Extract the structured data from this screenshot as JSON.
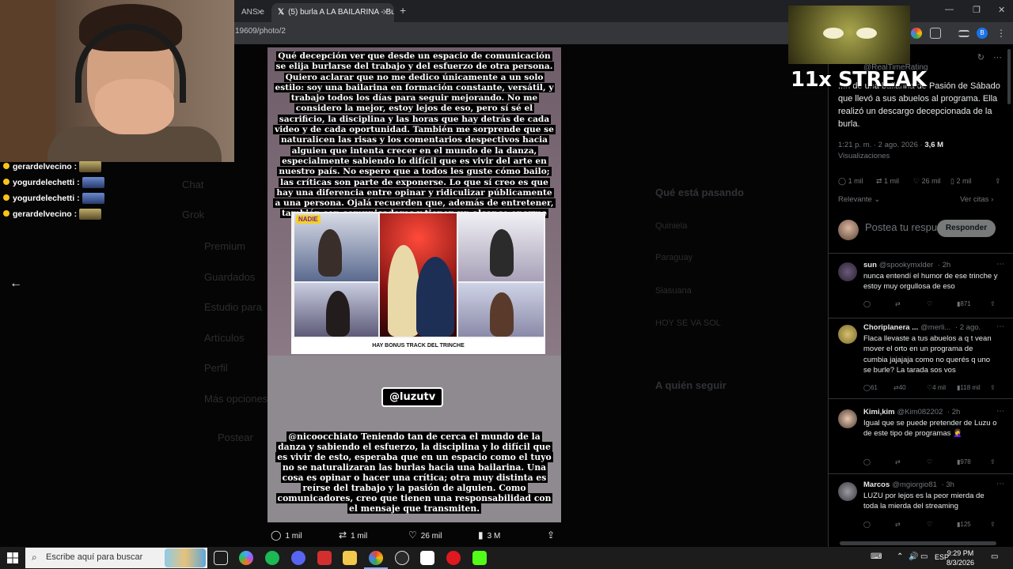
{
  "browser": {
    "tab_prev_label": "ANS e",
    "tab_active_label": "(5) burla A LA BAILARINA - Bus",
    "url_fragment": "19609/photo/2"
  },
  "media": {
    "caption_top": "Qué decepción ver que desde un espacio de comunicación se elija burlarse del trabajo y del esfuerzo de otra persona. Quiero aclarar que no me dedico únicamente a un solo estilo: soy una bailarina en formación constante, versátil, y trabajo todos los días para seguir mejorando. No me considero la mejor, estoy lejos de eso, pero sí sé el sacrificio, la disciplina y las horas que hay detrás de cada video y de cada oportunidad. También me sorprende que se naturalicen las risas y los comentarios despectivos hacia alguien que intenta crecer en el mundo de la danza, especialmente sabiendo lo difícil que es vivir del arte en nuestro país. No espero que a todos les guste cómo bailo; las críticas son parte de exponerse. Lo que sí creo es que hay una diferencia entre opinar y ridiculizar públicamente a una persona. Ojalá recuerden que, además de entretener, también son comunicadores y tienen un alcance enorme sobre mucha gente.",
    "collage_logo": "NADIE",
    "collage_banner": "HAY BONUS TRACK DEL TRINCHE",
    "tag": "@luzutv",
    "caption_bottom": "@nicoocchiato Teniendo tan de cerca el mundo de la danza y sabiendo el esfuerzo, la disciplina y lo difícil que es vivir de esto, esperaba que en un espacio como el tuyo no se naturalizaran las burlas hacia una bailarina. Una cosa es opinar o hacer una crítica; otra muy distinta es reírse del trabajo y la pasión de alguien. Como comunicadores, creo que tienen una responsabilidad con el mensaje que transmiten."
  },
  "media_actions": {
    "replies": "1 mil",
    "reposts": "1 mil",
    "likes": "26 mil",
    "views": "3 M"
  },
  "dim_nav": [
    "Chat",
    "Grok",
    "Premium",
    "Guardados",
    "Estudio para",
    "Artículos",
    "Perfil",
    "Más opciones"
  ],
  "dim_post_button": "Postear",
  "dim_right": {
    "trending_heading": "Qué está pasando",
    "who_to_follow_heading": "A quién seguir",
    "items": [
      "Quiniela",
      "Paraguay",
      "Siasuana",
      "HOY SE VA SOL"
    ]
  },
  "post": {
    "handle": "@RealTimeRating",
    "text": "...n de una bailarina de Pasión de Sábado que llevó a sus abuelos al programa. Ella realizó un descargo decepcionada de la burla.",
    "time": "1:21 p. m. · 2 ago. 2026 · ",
    "views_count": "3,6 M",
    "views_label": "Visualizaciones",
    "replies": "1 mil",
    "reposts": "1 mil",
    "likes": "26 mil",
    "bookmarks": "2 mil",
    "sort_label": "Relevante",
    "quotes_label": "Ver citas"
  },
  "reply_box": {
    "placeholder": "Postea tu respuesta",
    "button": "Responder"
  },
  "replies": [
    {
      "name": "sun",
      "handle": "@spookymxlder",
      "time": "· 2h",
      "text": "nunca entendí el humor de ese trinche y estoy muy orgullosa de eso",
      "views": "871",
      "reposts": "",
      "likes": ""
    },
    {
      "name": "Choriplanera ...",
      "handle": "@merli...",
      "time": "· 2 ago.",
      "text": "Flaca llevaste a tus abuelos a q t vean mover el orto en un programa de cumbia jajajaja como no querés q uno se burle? La tarada sos vos",
      "replies": "61",
      "reposts": "40",
      "likes": "4 mil",
      "views": "118 mil"
    },
    {
      "name": "Kimi,kim",
      "handle": "@Kim082202",
      "time": "· 2h",
      "text": "Igual que se puede pretender de Luzu o de este tipo de programas 🤦‍♀️",
      "views": "978",
      "reposts": "",
      "likes": ""
    },
    {
      "name": "Marcos",
      "handle": "@mgiorgio81",
      "time": "· 3h",
      "text": "LUZU por lejos es la peor mierda de toda la mierda del streaming",
      "views": "125",
      "reposts": "",
      "likes": ""
    }
  ],
  "chat": [
    {
      "user": "gerardelvecino",
      "sep": ":"
    },
    {
      "user": "yogurdelechetti",
      "sep": ":"
    },
    {
      "user": "yogurdelechetti",
      "sep": ":"
    },
    {
      "user": "gerardelvecino",
      "sep": ":"
    }
  ],
  "streak_text": "11x STREAK",
  "taskbar": {
    "search_placeholder": "Escribe aquí para buscar",
    "lang": "ESP",
    "time": "9:29 PM",
    "date": "8/3/2026"
  },
  "colors": {
    "page_bg": "#050505",
    "accent_blue": "#1d9bf0",
    "muted": "#71767b",
    "media_bg": "#8a7c86"
  },
  "icons": [
    "back-arrow-icon",
    "reply-icon",
    "repost-icon",
    "like-icon",
    "views-icon",
    "share-icon",
    "bookmark-icon",
    "more-icon",
    "search-icon",
    "windows-icon"
  ]
}
